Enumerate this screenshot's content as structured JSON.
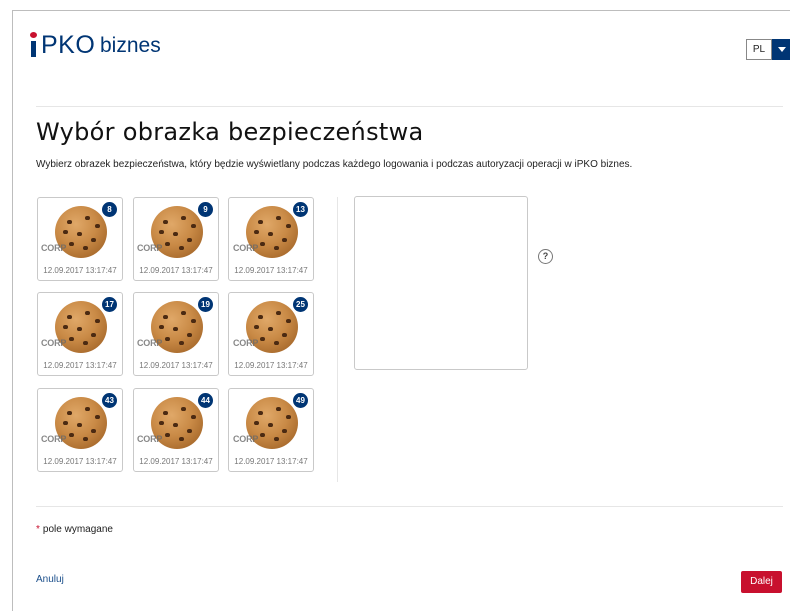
{
  "header": {
    "logo_pko": "PKO",
    "logo_suffix": "biznes",
    "language": {
      "value": "PL",
      "dropdown_icon": "caret-down-icon"
    }
  },
  "page": {
    "title": "Wybór obrazka bezpieczeństwa",
    "description": "Wybierz obrazek bezpieczeństwa, który będzie wyświetlany podczas każdego logowania i podczas autoryzacji operacji w iPKO biznes."
  },
  "images": [
    {
      "number": "8",
      "watermark": "CORP",
      "timestamp": "12.09.2017 13:17:47"
    },
    {
      "number": "9",
      "watermark": "CORP",
      "timestamp": "12.09.2017 13:17:47"
    },
    {
      "number": "13",
      "watermark": "CORP",
      "timestamp": "12.09.2017 13:17:47"
    },
    {
      "number": "17",
      "watermark": "CORP",
      "timestamp": "12.09.2017 13:17:47"
    },
    {
      "number": "19",
      "watermark": "CORP",
      "timestamp": "12.09.2017 13:17:47"
    },
    {
      "number": "25",
      "watermark": "CORP",
      "timestamp": "12.09.2017 13:17:47"
    },
    {
      "number": "43",
      "watermark": "CORP",
      "timestamp": "12.09.2017 13:17:47"
    },
    {
      "number": "44",
      "watermark": "CORP",
      "timestamp": "12.09.2017 13:17:47"
    },
    {
      "number": "49",
      "watermark": "CORP",
      "timestamp": "12.09.2017 13:17:47"
    }
  ],
  "preview": {
    "help_label": "?"
  },
  "form": {
    "required_mark": "*",
    "required_note": "pole wymagane"
  },
  "actions": {
    "cancel_label": "Anuluj",
    "next_label": "Dalej"
  },
  "colors": {
    "brand_navy": "#003574",
    "brand_red": "#c8102e"
  }
}
